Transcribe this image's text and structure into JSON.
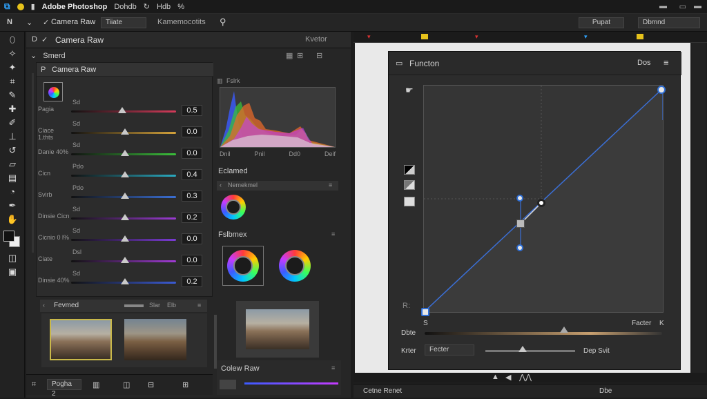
{
  "menubar": {
    "app_title": "Adobe Photoshop",
    "menu1": "Dohdb",
    "menu2": "Hdb",
    "menu3": "%"
  },
  "optbar": {
    "mode": "Camera Raw",
    "field1": "Tiiate",
    "field2": "Kamemocotits",
    "right_field1": "Pupat",
    "right_field2": "Dbmnd"
  },
  "raw_header": {
    "title": "Camera Raw",
    "right": "Kvetor"
  },
  "smart": {
    "label": "Smerd"
  },
  "raw_panel": {
    "title": "Camera Raw"
  },
  "sliders": [
    {
      "left": "Pagia",
      "top": "Sd",
      "value": "0.5",
      "color": "#d43b5a",
      "pos": 0.49
    },
    {
      "left": "Ciace 1.thts",
      "top": "Sd",
      "value": "0.0",
      "color": "#d4a23b",
      "pos": 0.51
    },
    {
      "left": "Danie 40%",
      "top": "Sd",
      "value": "0.0",
      "color": "#3bbf3b",
      "pos": 0.51
    },
    {
      "left": "Cicn",
      "top": "Pdo",
      "value": "0.4",
      "color": "#2aaac0",
      "pos": 0.51
    },
    {
      "left": "Svirb",
      "top": "Pdo",
      "value": "0.3",
      "color": "#3b6fd4",
      "pos": 0.51
    },
    {
      "left": "Dinsie Cicn",
      "top": "Sd",
      "value": "0.2",
      "color": "#9b3bd4",
      "pos": 0.51
    },
    {
      "left": "Cicnio 0 l%",
      "top": "Sd",
      "value": "0.0",
      "color": "#7a3bd4",
      "pos": 0.51
    },
    {
      "left": "Ciate",
      "top": "Dsl",
      "value": "0.0",
      "color": "#a03bd4",
      "pos": 0.51
    },
    {
      "left": "Dinsie 40%",
      "top": "Sd",
      "value": "0.2",
      "color": "#3b5bd4",
      "pos": 0.51
    }
  ],
  "favorites": {
    "title": "Fevmed",
    "label1": "Slar",
    "label2": "Elb"
  },
  "histogram": {
    "title": "Fslrk",
    "labels": [
      "Dnil",
      "Pnil",
      "Dd0",
      "Deif"
    ]
  },
  "colorwheel_section": {
    "title": "Eclamed",
    "subtitle": "Nemekmel"
  },
  "balance_section": {
    "title": "Fslbmex"
  },
  "bottom_left": {
    "tab": "Pogha 2"
  },
  "bottom_mid": {
    "title": "Colew Raw"
  },
  "curves": {
    "title": "Functon",
    "right": "Dos",
    "label_s": "S",
    "label_factor": "Facter",
    "label_k": "K",
    "label_r": "R:",
    "axis_label": "Dbte",
    "bottom_label": "Krter",
    "preset": "Fecter",
    "bottom_right": "Dep Svit"
  },
  "statusbar": {
    "center": "Cetne Renet",
    "right": "Dbe"
  },
  "colors": {
    "accent": "#2f6fd6",
    "curve": "#3b6fd6",
    "bg": "#1c1c1c"
  }
}
